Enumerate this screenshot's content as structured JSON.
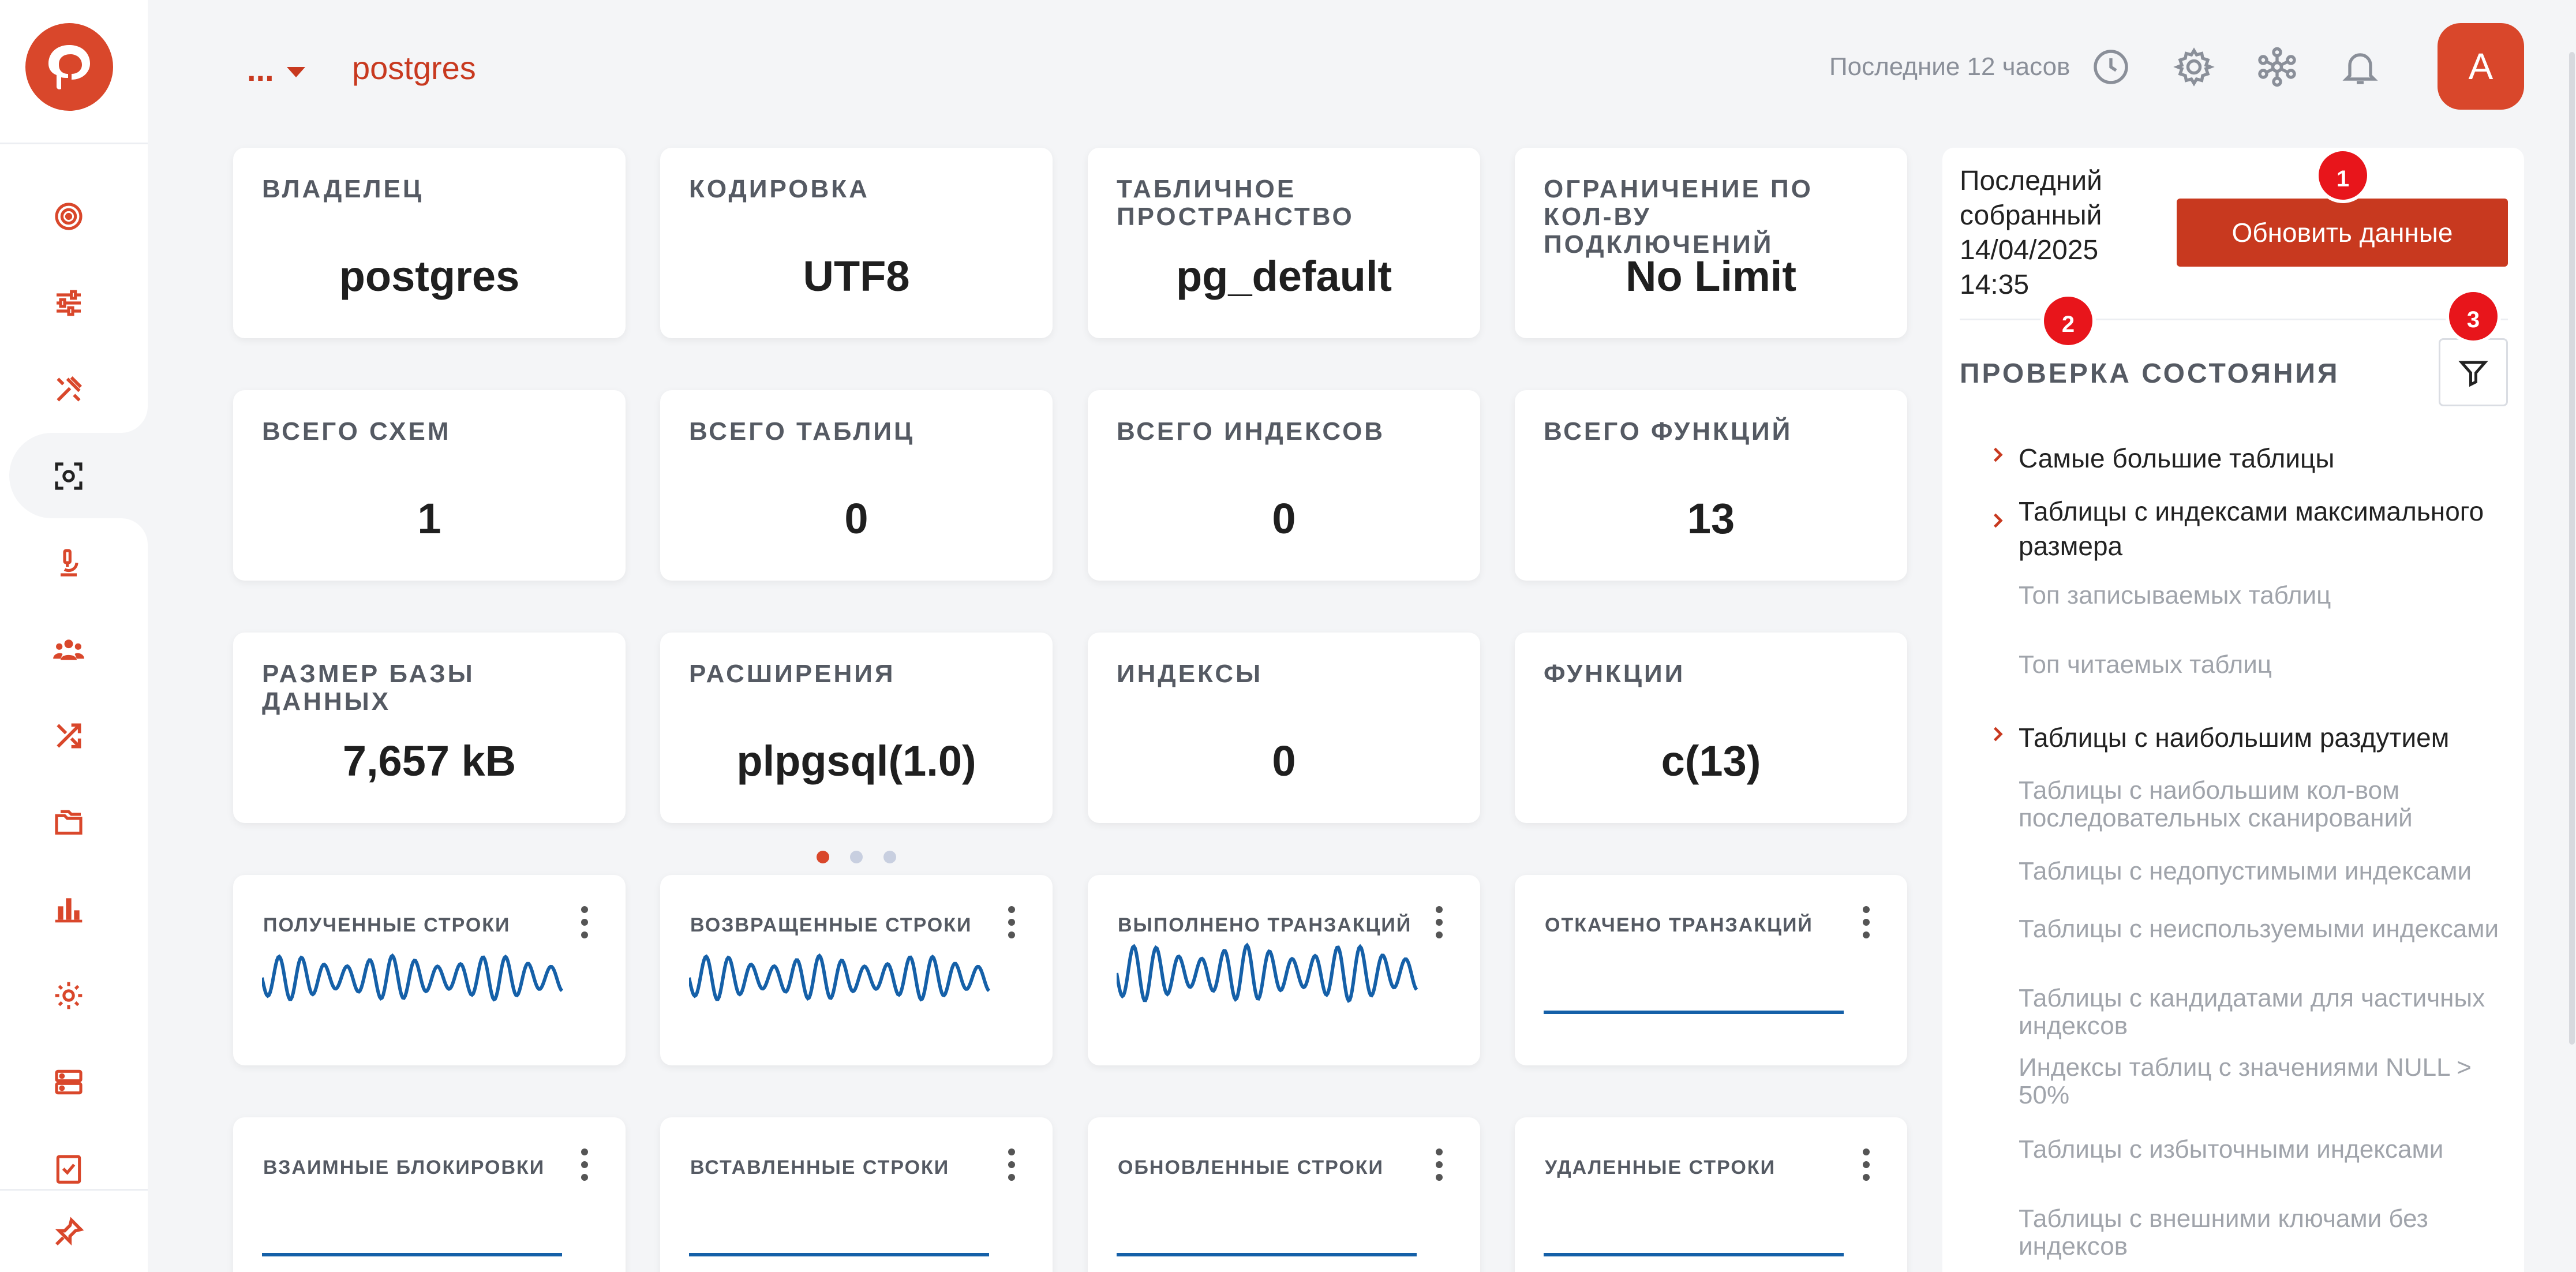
{
  "app": {
    "menu_label": "...",
    "db_name": "postgres",
    "time_range": "Последние 12 часов",
    "avatar_letter": "A"
  },
  "colors": {
    "accent": "#d9472b",
    "accent_dark": "#c8391f",
    "spark_line": "#1560a8",
    "badge": "#e8151b"
  },
  "sidebar": {
    "items": [
      {
        "icon": "target-icon"
      },
      {
        "icon": "sliders-icon"
      },
      {
        "icon": "tools-icon"
      },
      {
        "icon": "scan-icon",
        "active": true
      },
      {
        "icon": "microscope-icon"
      },
      {
        "icon": "users-icon"
      },
      {
        "icon": "shuffle-icon"
      },
      {
        "icon": "folders-icon"
      },
      {
        "icon": "bar-chart-icon"
      },
      {
        "icon": "settings-icon"
      },
      {
        "icon": "servers-icon"
      },
      {
        "icon": "checklist-icon"
      }
    ],
    "pin_icon": "pin-icon"
  },
  "cards": [
    {
      "label": "ВЛАДЕЛЕЦ",
      "value": "postgres"
    },
    {
      "label": "КОДИРОВКА",
      "value": "UTF8"
    },
    {
      "label": "ТАБЛИЧНОЕ ПРОСТРАНСТВО",
      "value": "pg_default"
    },
    {
      "label": "ОГРАНИЧЕНИЕ ПО КОЛ-ВУ ПОДКЛЮЧЕНИЙ",
      "value": "No Limit"
    },
    {
      "label": "ВСЕГО СХЕМ",
      "value": "1"
    },
    {
      "label": "ВСЕГО ТАБЛИЦ",
      "value": "0"
    },
    {
      "label": "ВСЕГО ИНДЕКСОВ",
      "value": "0"
    },
    {
      "label": "ВСЕГО ФУНКЦИЙ",
      "value": "13"
    },
    {
      "label": "РАЗМЕР БАЗЫ ДАННЫХ",
      "value": "7,657 kB"
    },
    {
      "label": "РАСШИРЕНИЯ",
      "value": "plpgsql(1.0)"
    },
    {
      "label": "ИНДЕКСЫ",
      "value": "0"
    },
    {
      "label": "ФУНКЦИИ",
      "value": "c(13)"
    }
  ],
  "extensions_carousel": {
    "pages": 3,
    "current": 1
  },
  "sparklines": [
    {
      "label": "ПОЛУЧЕННЫЕ СТРОКИ",
      "shape": "wave"
    },
    {
      "label": "ВОЗВРАЩЕННЫЕ СТРОКИ",
      "shape": "wave"
    },
    {
      "label": "ВЫПОЛНЕНО ТРАНЗАКЦИЙ",
      "shape": "wave-strong"
    },
    {
      "label": "ОТКАЧЕНО ТРАНЗАКЦИЙ",
      "shape": "flat"
    },
    {
      "label": "ВЗАИМНЫЕ БЛОКИРОВКИ",
      "shape": "flat"
    },
    {
      "label": "ВСТАВЛЕННЫЕ СТРОКИ",
      "shape": "flat"
    },
    {
      "label": "ОБНОВЛЕННЫЕ СТРОКИ",
      "shape": "flat"
    },
    {
      "label": "УДАЛЕННЫЕ СТРОКИ",
      "shape": "flat"
    }
  ],
  "panel": {
    "last_collected": "Последний собранный 14/04/2025 14:35",
    "refresh_label": "Обновить данные",
    "health_title": "ПРОВЕРКА СОСТОЯНИЯ",
    "badges": [
      "1",
      "2",
      "3"
    ],
    "checks": [
      {
        "label": "Самые большие таблицы",
        "expandable": true
      },
      {
        "label": "Таблицы с индексами максимального размера",
        "expandable": true
      },
      {
        "label": "Топ записываемых таблиц",
        "expandable": false
      },
      {
        "label": "Топ читаемых таблиц",
        "expandable": false
      },
      {
        "label": "Таблицы с наибольшим раздутием",
        "expandable": true
      },
      {
        "label": "Таблицы с наибольшим кол-вом последовательных сканирований",
        "expandable": false
      },
      {
        "label": "Таблицы с недопустимыми индексами",
        "expandable": false
      },
      {
        "label": "Таблицы с неиспользуемыми индексами",
        "expandable": false
      },
      {
        "label": "Таблицы с кандидатами для частичных индексов",
        "expandable": false
      },
      {
        "label": "Индексы таблиц с значениями NULL > 50%",
        "expandable": false
      },
      {
        "label": "Таблицы с избыточными индексами",
        "expandable": false
      },
      {
        "label": "Таблицы с внешними ключами без индексов",
        "expandable": false
      }
    ]
  }
}
